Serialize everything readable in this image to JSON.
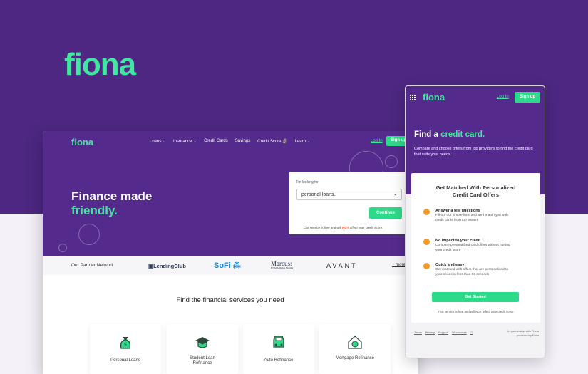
{
  "brand": {
    "logo": "fiona",
    "accent": "#43e6a0",
    "purple": "#552a8d",
    "cta": "#2fd98a"
  },
  "desktop": {
    "nav": {
      "logo": "fiona",
      "items": [
        {
          "label": "Loans ⌄"
        },
        {
          "label": "Insurance ⌄"
        },
        {
          "label": "Credit Cards"
        },
        {
          "label": "Savings"
        },
        {
          "label": "Credit Score 🗿"
        },
        {
          "label": "Learn ⌄"
        }
      ],
      "login": "Log In",
      "signup": "Sign up"
    },
    "hero": {
      "line1": "Finance made",
      "line2": "friendly."
    },
    "search_card": {
      "label": "I'm looking for",
      "selected": "personal loans.",
      "chevron": "⌄",
      "continue": "Continue",
      "note_prefix": "Our service is free and will ",
      "note_emph": "NOT",
      "note_suffix": " affect your credit score."
    },
    "partners": {
      "label": "Our Partner Network",
      "items": [
        "▣LendingClub",
        "SoFi ⁂",
        "Marcus:",
        "AVANT"
      ],
      "marcus_sub": "BY GOLDMAN SACHS",
      "more": "+ more"
    },
    "section_title": "Find the financial services you need",
    "tiles": [
      {
        "label": "Personal Loans"
      },
      {
        "label": "Student Loan Refinance"
      },
      {
        "label": "Auto Refinance"
      },
      {
        "label": "Mortgage Refinance"
      }
    ]
  },
  "mobile": {
    "logo": "fiona",
    "login": "Log In",
    "signup": "Sign up",
    "title_prefix": "Find a ",
    "title_highlight": "credit card.",
    "subtitle": "Compare and choose offers from top providers to find the credit card that suits your needs.",
    "card_title": "Get Matched With Personalized Credit Card Offers",
    "steps": [
      {
        "title": "Answer a few questions",
        "desc": "Fill out our simple form and we'll match you with credit cards from top issuers"
      },
      {
        "title": "No impact to your credit",
        "desc": "Compare personalized card offers without hurting your credit score"
      },
      {
        "title": "Quick and easy",
        "desc": "Get matched with offers that are personalized to your needs in less than 60 seconds"
      }
    ],
    "cta": "Get Started",
    "free_note": "This service is free and will NOT affect your credit score",
    "footer_links": [
      "Terms",
      "Privacy",
      "Support",
      "Disclosures"
    ],
    "footer_right_1": "In partnership with Fiona",
    "footer_right_2": "powered by Even"
  }
}
